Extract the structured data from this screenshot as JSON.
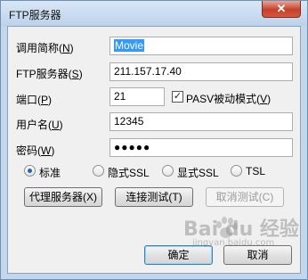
{
  "window": {
    "title": "FTP服务器",
    "close_glyph": "✕"
  },
  "form": {
    "name_label": "调用简称(",
    "name_key": "N",
    "name_value": "Movie",
    "server_label": "FTP服务器(",
    "server_key": "S",
    "server_value": "211.157.17.40",
    "port_label": "端口(",
    "port_key": "P",
    "port_value": "21",
    "pasv_label": "PASV被动模式(",
    "pasv_key": "V",
    "pasv_checked": true,
    "pasv_check_glyph": "✓",
    "user_label": "用户名(",
    "user_key": "U",
    "user_value": "12345",
    "pwd_label": "密码(",
    "pwd_key": "W",
    "pwd_value": "●●●●●"
  },
  "encryption": {
    "options": [
      "标准",
      "隐式SSL",
      "显式SSL",
      "TSL"
    ],
    "selected": "标准"
  },
  "buttons": {
    "proxy": "代理服务器(X)",
    "test": "连接测试(T)",
    "cancel_test": "取消测试(C)",
    "ok": "确定",
    "cancel": "取消"
  },
  "watermark": {
    "text": "Bai du 经验",
    "sub": "jingyan.baidu.com"
  },
  "colors": {
    "selection": "#3399ff",
    "radio_dot": "#1f62c8",
    "close_button": "#c5412a"
  }
}
